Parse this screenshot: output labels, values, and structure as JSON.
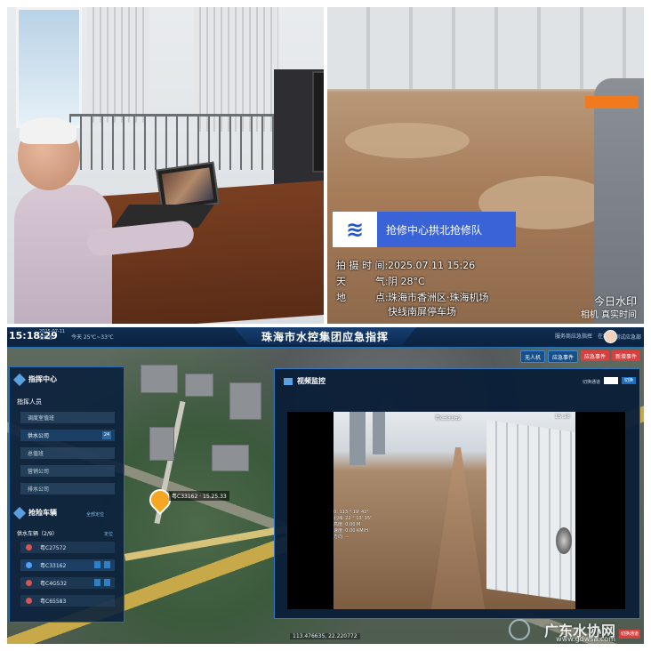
{
  "watermark": {
    "team": "抢修中心拱北抢修队",
    "logo_glyph": "≋",
    "shot_time_label": "拍 摄 时 间:",
    "shot_time_value": "2025.07.11 15:26",
    "weather_label": "天　　　气:",
    "weather_value": "阴 28°C",
    "location_label": "地　　　点:",
    "location_line1": "珠海市香洲区·珠海机场",
    "location_line2": "快线南屏停车场",
    "app_name": "今日水印",
    "app_sub": "相机 真实时间"
  },
  "dashboard": {
    "clock": "15:18:29",
    "date": "2025-07-11",
    "weekday": "星期五",
    "weather": "今天 25℃~33℃",
    "system_title": "珠海市水控集团应急指挥",
    "top_right": "服务商应急指挥　在线",
    "user": "测试应急部",
    "toolbar": {
      "btn1": "无人机",
      "btn2": "应急事件",
      "btn3": "应急事件",
      "btn4": "新增事件"
    },
    "left_panel": {
      "title": "指挥中心",
      "personnel_label": "指挥人员",
      "items": [
        {
          "label": "调度室值班"
        },
        {
          "label": "供水公司",
          "badge": "24"
        },
        {
          "label": "总值班"
        },
        {
          "label": "营销公司"
        },
        {
          "label": "排水公司"
        }
      ],
      "vehicles_title": "抢险车辆",
      "vehicles_link": "全部定位",
      "vehicle_group": "供水车辆（2/9）",
      "vehicle_group_link": "定位",
      "vehicles": [
        {
          "plate": "粤C27572"
        },
        {
          "plate": "粤C33162"
        },
        {
          "plate": "粤C4G532"
        },
        {
          "plate": "粤C65583"
        }
      ]
    },
    "map_marker": "粤C33162 · 15.25.33",
    "coords": "113.476635, 22.220772",
    "video_panel": {
      "title": "视频监控",
      "channel_label": "切换通道",
      "apply_button": "切换",
      "header_plate": "粤C33162",
      "header_time": "15:18",
      "osd_line1": "0: 113 ° 19' 42\"",
      "osd_line2": "北纬: 22 ° 13' 15\"",
      "osd_line3": "高度: 0.00 M",
      "osd_line4": "速度: 0.00 KM/H",
      "osd_line5": "方向: --"
    },
    "footer_logo": "广东水协网",
    "footer_url": "www.gdwsa.com",
    "red_tag": "切换通道"
  },
  "colors": {
    "accent": "#1f6fb5",
    "banner": "#3b63d8",
    "danger": "#d93f3f",
    "marker": "#f5a623"
  }
}
